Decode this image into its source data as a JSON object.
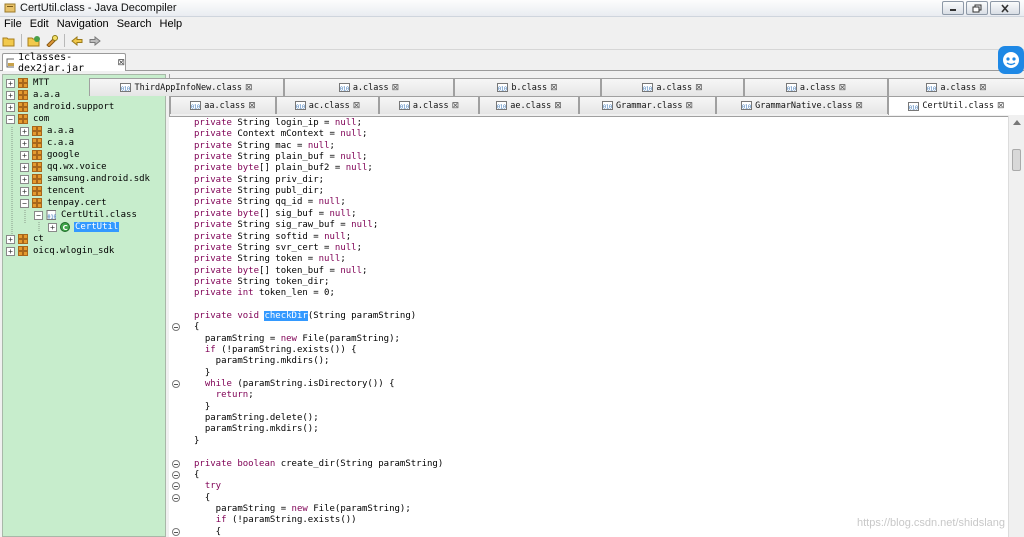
{
  "window": {
    "title": "CertUtil.class - Java Decompiler"
  },
  "menu": [
    "File",
    "Edit",
    "Navigation",
    "Search",
    "Help"
  ],
  "outer_tab": {
    "label": "1classes-dex2jar.jar",
    "close": "⊠"
  },
  "tree": [
    {
      "label": "MTT",
      "expander": "+",
      "indent": 0
    },
    {
      "label": "a.a.a",
      "expander": "+",
      "indent": 0
    },
    {
      "label": "android.support",
      "expander": "+",
      "indent": 0
    },
    {
      "label": "com",
      "expander": "−",
      "indent": 0
    },
    {
      "label": "a.a.a",
      "expander": "+",
      "indent": 1
    },
    {
      "label": "c.a.a",
      "expander": "+",
      "indent": 1
    },
    {
      "label": "google",
      "expander": "+",
      "indent": 1
    },
    {
      "label": "qq.wx.voice",
      "expander": "+",
      "indent": 1
    },
    {
      "label": "samsung.android.sdk",
      "expander": "+",
      "indent": 1
    },
    {
      "label": "tencent",
      "expander": "+",
      "indent": 1
    },
    {
      "label": "tenpay.cert",
      "expander": "−",
      "indent": 1
    },
    {
      "label": "CertUtil.class",
      "expander": "−",
      "indent": 2,
      "type": "class"
    },
    {
      "label": "CertUtil",
      "expander": "+",
      "indent": 3,
      "type": "type",
      "selected": true
    },
    {
      "label": "ct",
      "expander": "+",
      "indent": 0
    },
    {
      "label": "oicq.wlogin_sdk",
      "expander": "+",
      "indent": 0
    }
  ],
  "tabs_row1": [
    "ThirdAppInfoNew.class",
    "a.class",
    "b.class",
    "a.class",
    "a.class",
    "a.class"
  ],
  "tabs_row2": [
    "aa.class",
    "ac.class",
    "a.class",
    "ae.class",
    "Grammar.class",
    "GrammarNative.class",
    "CertUtil.class"
  ],
  "code": [
    [
      [
        "kw",
        "private "
      ],
      [
        "",
        "String login_ip = "
      ],
      [
        "kw",
        "null"
      ],
      [
        "",
        ";"
      ]
    ],
    [
      [
        "kw",
        "private "
      ],
      [
        "",
        "Context mContext = "
      ],
      [
        "kw",
        "null"
      ],
      [
        "",
        ";"
      ]
    ],
    [
      [
        "kw",
        "private "
      ],
      [
        "",
        "String mac = "
      ],
      [
        "kw",
        "null"
      ],
      [
        "",
        ";"
      ]
    ],
    [
      [
        "kw",
        "private "
      ],
      [
        "",
        "String plain_buf = "
      ],
      [
        "kw",
        "null"
      ],
      [
        "",
        ";"
      ]
    ],
    [
      [
        "kw",
        "private byte"
      ],
      [
        "",
        "[] plain_buf2 = "
      ],
      [
        "kw",
        "null"
      ],
      [
        "",
        ";"
      ]
    ],
    [
      [
        "kw",
        "private "
      ],
      [
        "",
        "String priv_dir;"
      ]
    ],
    [
      [
        "kw",
        "private "
      ],
      [
        "",
        "String publ_dir;"
      ]
    ],
    [
      [
        "kw",
        "private "
      ],
      [
        "",
        "String qq_id = "
      ],
      [
        "kw",
        "null"
      ],
      [
        "",
        ";"
      ]
    ],
    [
      [
        "kw",
        "private byte"
      ],
      [
        "",
        "[] sig_buf = "
      ],
      [
        "kw",
        "null"
      ],
      [
        "",
        ";"
      ]
    ],
    [
      [
        "kw",
        "private "
      ],
      [
        "",
        "String sig_raw_buf = "
      ],
      [
        "kw",
        "null"
      ],
      [
        "",
        ";"
      ]
    ],
    [
      [
        "kw",
        "private "
      ],
      [
        "",
        "String softid = "
      ],
      [
        "kw",
        "null"
      ],
      [
        "",
        ";"
      ]
    ],
    [
      [
        "kw",
        "private "
      ],
      [
        "",
        "String svr_cert = "
      ],
      [
        "kw",
        "null"
      ],
      [
        "",
        ";"
      ]
    ],
    [
      [
        "kw",
        "private "
      ],
      [
        "",
        "String token = "
      ],
      [
        "kw",
        "null"
      ],
      [
        "",
        ";"
      ]
    ],
    [
      [
        "kw",
        "private byte"
      ],
      [
        "",
        "[] token_buf = "
      ],
      [
        "kw",
        "null"
      ],
      [
        "",
        ";"
      ]
    ],
    [
      [
        "kw",
        "private "
      ],
      [
        "",
        "String token_dir;"
      ]
    ],
    [
      [
        "kw",
        "private int "
      ],
      [
        "",
        "token_len = 0;"
      ]
    ],
    [],
    [
      [
        "kw",
        "private void "
      ],
      [
        "hl",
        "checkDir"
      ],
      [
        "",
        "(String paramString)"
      ]
    ],
    [
      [
        "",
        "{"
      ]
    ],
    [
      [
        "",
        "  paramString = "
      ],
      [
        "kw",
        "new "
      ],
      [
        "",
        "File(paramString);"
      ]
    ],
    [
      [
        "",
        "  "
      ],
      [
        "kw",
        "if "
      ],
      [
        "",
        "(!paramString.exists()) {"
      ]
    ],
    [
      [
        "",
        "    paramString.mkdirs();"
      ]
    ],
    [
      [
        "",
        "  }"
      ]
    ],
    [
      [
        "",
        "  "
      ],
      [
        "kw",
        "while "
      ],
      [
        "",
        "(paramString.isDirectory()) {"
      ]
    ],
    [
      [
        "",
        "    "
      ],
      [
        "kw",
        "return"
      ],
      [
        "",
        ";"
      ]
    ],
    [
      [
        "",
        "  }"
      ]
    ],
    [
      [
        "",
        "  paramString.delete();"
      ]
    ],
    [
      [
        "",
        "  paramString.mkdirs();"
      ]
    ],
    [
      [
        "",
        "}"
      ]
    ],
    [],
    [
      [
        "kw",
        "private boolean "
      ],
      [
        "",
        "create_dir(String paramString)"
      ]
    ],
    [
      [
        "",
        "{"
      ]
    ],
    [
      [
        "",
        "  "
      ],
      [
        "kw",
        "try"
      ]
    ],
    [
      [
        "",
        "  {"
      ]
    ],
    [
      [
        "",
        "    paramString = "
      ],
      [
        "kw",
        "new "
      ],
      [
        "",
        "File(paramString);"
      ]
    ],
    [
      [
        "",
        "    "
      ],
      [
        "kw",
        "if "
      ],
      [
        "",
        "(!paramString.exists())"
      ]
    ],
    [
      [
        "",
        "    {"
      ]
    ]
  ],
  "watermark": "https://blog.csdn.net/shidslang"
}
